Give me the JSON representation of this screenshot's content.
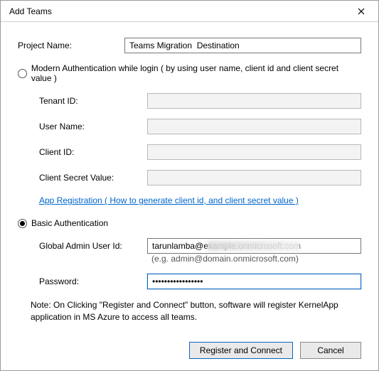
{
  "titlebar": {
    "title": "Add Teams"
  },
  "project": {
    "label": "Project Name:",
    "value": "Teams Migration  Destination"
  },
  "modernAuth": {
    "radio_label": "Modern Authentication while login ( by using user name, client id and client secret value )",
    "tenant_label": "Tenant ID:",
    "tenant_value": "",
    "username_label": "User Name:",
    "username_value": "",
    "clientid_label": "Client ID:",
    "clientid_value": "",
    "clientsecret_label": "Client Secret Value:",
    "clientsecret_value": "",
    "link": "App Registration ( How to generate client id, and client secret value )"
  },
  "basicAuth": {
    "radio_label": "Basic Authentication",
    "userid_label": "Global Admin User Id:",
    "userid_value": "tarunlamba@example.onmicrosoft.com",
    "userid_hint": "(e.g. admin@domain.onmicrosoft.com)",
    "password_label": "Password:",
    "password_value": "•••••••••••••••••"
  },
  "note": "Note: On Clicking \"Register and Connect\" button, software will register KernelApp application in MS Azure to access all teams.",
  "footer": {
    "primary": "Register and Connect",
    "cancel": "Cancel"
  }
}
